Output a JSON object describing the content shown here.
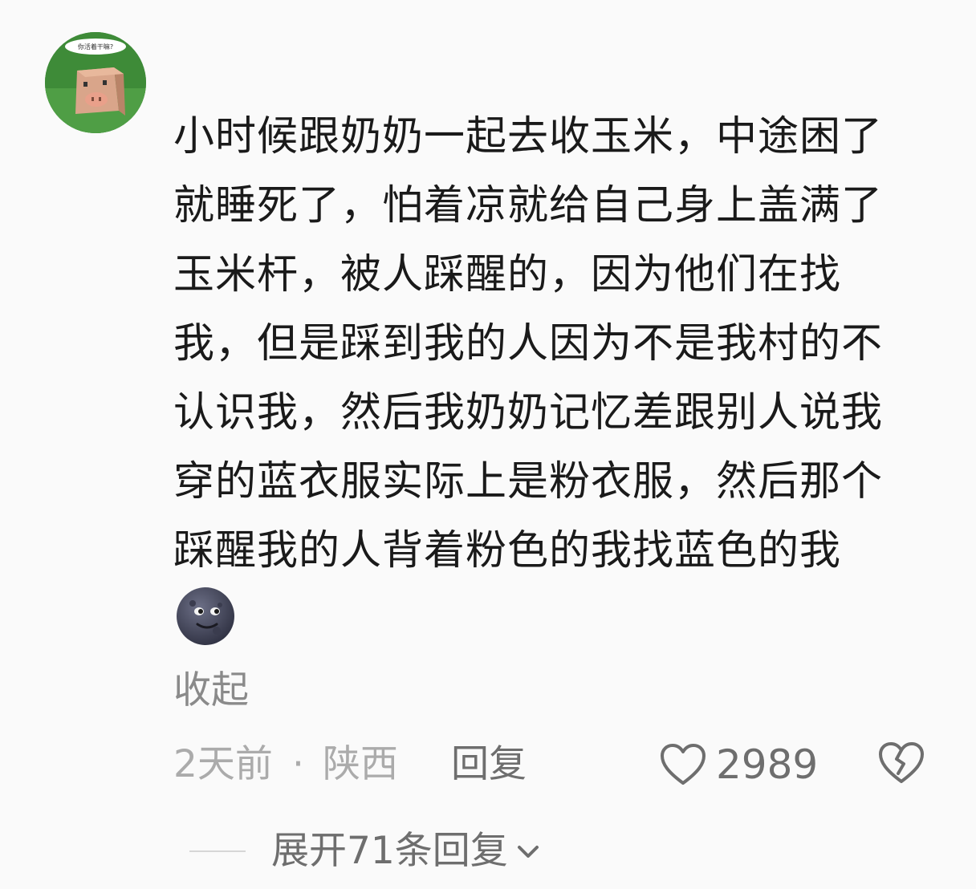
{
  "user": {
    "avatar_icon": "pig-cartoon-avatar",
    "avatar_caption": "你活着干嘛?"
  },
  "comment": {
    "text": "小时候跟奶奶一起去收玉米，中途困了就睡死了，怕着凉就给自己身上盖满了玉米杆，被人踩醒的，因为他们在找我，但是踩到我的人因为不是我村的不认识我，然后我奶奶记忆差跟别人说我穿的蓝衣服实际上是粉衣服，然后那个踩醒我的人背着粉色的我找蓝色的我",
    "emoji_icon": "new-moon-face-emoji",
    "collapse_label": "收起"
  },
  "meta": {
    "time": "2天前",
    "separator": "·",
    "location": "陕西",
    "reply_label": "回复",
    "like_icon": "heart-outline-icon",
    "like_count": "2989",
    "dislike_icon": "broken-heart-icon"
  },
  "replies": {
    "expand_label": "展开71条回复",
    "chevron_icon": "chevron-down-icon"
  },
  "colors": {
    "background": "#fafafa",
    "text_primary": "#1a1a1a",
    "text_secondary": "#6e6e6e",
    "text_muted": "#ababab"
  }
}
